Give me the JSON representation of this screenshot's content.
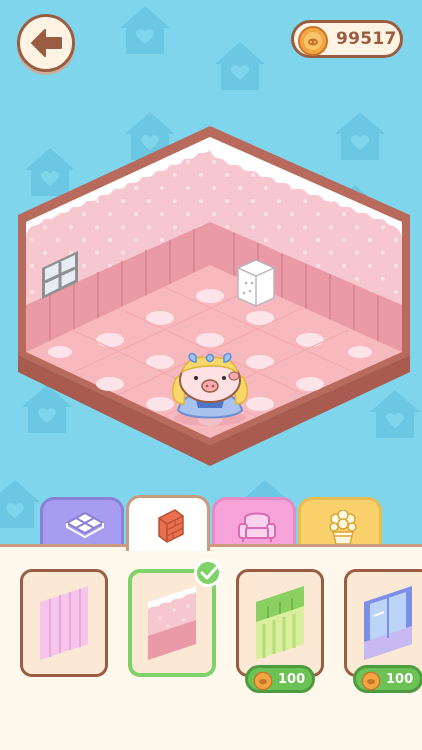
{
  "header": {
    "coins": "99517"
  },
  "tabs": [
    {
      "name": "floor",
      "color": "#a79cf0",
      "icon": "floor-tile-icon"
    },
    {
      "name": "wall",
      "color": "#ffffff",
      "icon": "brick-icon",
      "active": true
    },
    {
      "name": "furniture",
      "color": "#f5a3d8",
      "icon": "armchair-icon"
    },
    {
      "name": "decor",
      "color": "#fbd16b",
      "icon": "flower-pot-icon"
    }
  ],
  "items": [
    {
      "name": "pink-stripe-wallpaper",
      "price": ""
    },
    {
      "name": "pink-heart-wallpaper",
      "price": "",
      "selected": true
    },
    {
      "name": "green-wallpaper",
      "price": "100"
    },
    {
      "name": "blue-window-wallpaper",
      "price": "100"
    }
  ],
  "colors": {
    "sky": "#7fd6ec",
    "wall_pink": "#f7c7cf",
    "floor_pink": "#f7b9bd",
    "trim": "#b86a5c",
    "accent_green": "#7ed267"
  }
}
